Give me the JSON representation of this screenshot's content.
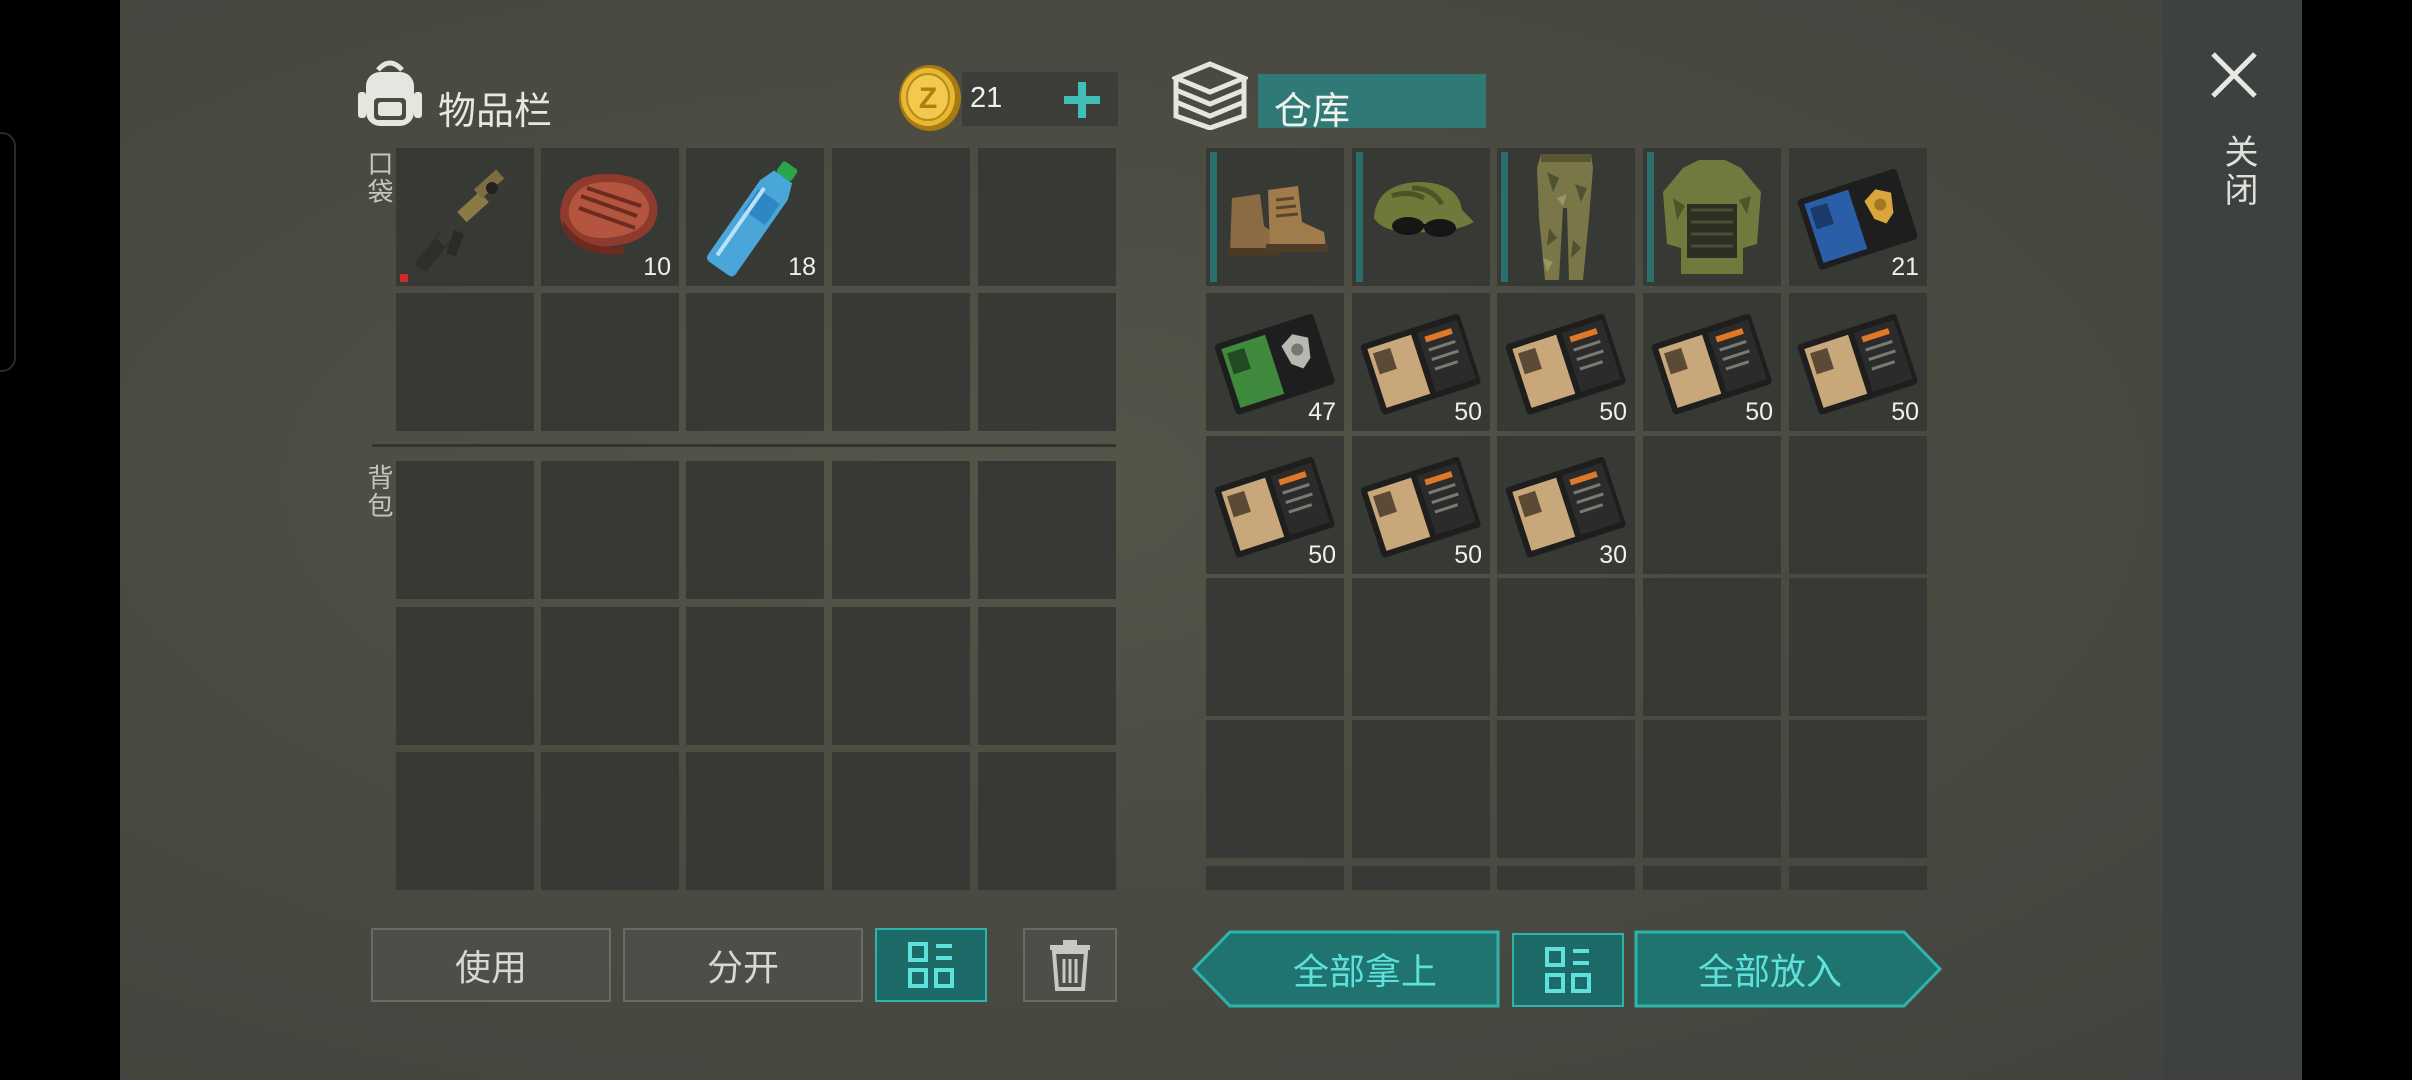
{
  "inventory": {
    "title": "物品栏",
    "coin_value": "21",
    "pocket_label": "口袋",
    "backpack_label": "背包",
    "pocket_items": [
      {
        "icon": "rifle-icon",
        "qty": ""
      },
      {
        "icon": "steak-icon",
        "qty": "10"
      },
      {
        "icon": "water-bottle-icon",
        "qty": "18"
      }
    ]
  },
  "storage": {
    "title": "仓库",
    "row1_items": [
      {
        "icon": "boots-icon",
        "qty": ""
      },
      {
        "icon": "cap-with-sunglasses-icon",
        "qty": ""
      },
      {
        "icon": "camo-pants-icon",
        "qty": ""
      },
      {
        "icon": "camo-vest-icon",
        "qty": ""
      },
      {
        "icon": "police-badge-wallet-icon",
        "qty": "21"
      }
    ],
    "row2_items": [
      {
        "icon": "sheriff-id-wallet-icon",
        "qty": "47"
      },
      {
        "icon": "patrol-officer-id-icon",
        "qty": "50"
      },
      {
        "icon": "patrol-officer-id-icon",
        "qty": "50"
      },
      {
        "icon": "patrol-officer-id-icon",
        "qty": "50"
      },
      {
        "icon": "patrol-officer-id-icon",
        "qty": "50"
      }
    ],
    "row3_items": [
      {
        "icon": "patrol-officer-id-icon",
        "qty": "50"
      },
      {
        "icon": "patrol-officer-id-icon",
        "qty": "50"
      },
      {
        "icon": "patrol-officer-id-icon",
        "qty": "30"
      }
    ]
  },
  "buttons": {
    "use": "使用",
    "split": "分开",
    "take_all": "全部拿上",
    "put_all": "全部放入"
  },
  "close_label": "关闭",
  "colors": {
    "accent_teal": "#1d6b68",
    "accent_teal_light": "#5fe0da",
    "slot_bg": "#373935",
    "panel_bg": "#4b4b42"
  }
}
